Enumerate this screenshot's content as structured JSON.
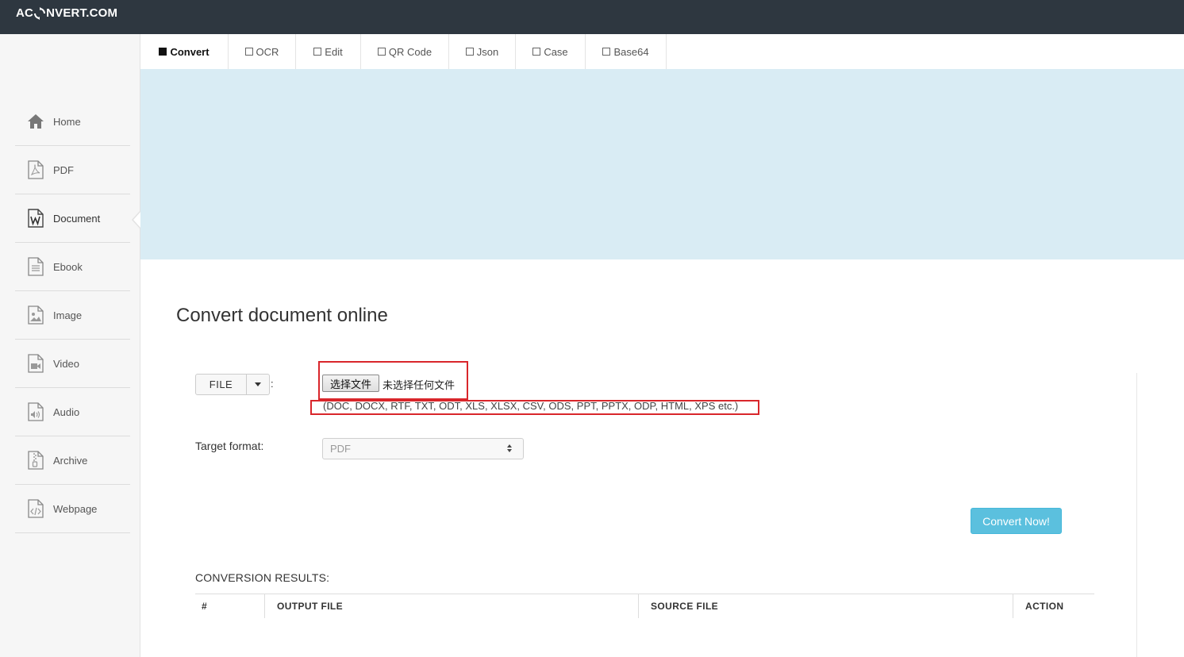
{
  "brand": {
    "logo_prefix": "AC",
    "logo_suffix": "NVERT.COM"
  },
  "tabs": [
    {
      "label": "Convert",
      "active": true
    },
    {
      "label": "OCR",
      "active": false
    },
    {
      "label": "Edit",
      "active": false
    },
    {
      "label": "QR Code",
      "active": false
    },
    {
      "label": "Json",
      "active": false
    },
    {
      "label": "Case",
      "active": false
    },
    {
      "label": "Base64",
      "active": false
    }
  ],
  "sidebar": {
    "items": [
      {
        "label": "Home",
        "icon": "home-icon"
      },
      {
        "label": "PDF",
        "icon": "pdf-file-icon"
      },
      {
        "label": "Document",
        "icon": "word-document-icon",
        "active": true
      },
      {
        "label": "Ebook",
        "icon": "ebook-icon"
      },
      {
        "label": "Image",
        "icon": "image-file-icon"
      },
      {
        "label": "Video",
        "icon": "video-file-icon"
      },
      {
        "label": "Audio",
        "icon": "audio-file-icon"
      },
      {
        "label": "Archive",
        "icon": "archive-file-icon"
      },
      {
        "label": "Webpage",
        "icon": "webpage-file-icon"
      }
    ]
  },
  "main": {
    "title": "Convert document online",
    "file_button": "FILE",
    "colon": ":",
    "choose_file_label": "选择文件",
    "no_file_chosen": "未选择任何文件",
    "supported_formats": "(DOC, DOCX, RTF, TXT, ODT, XLS, XLSX, CSV, ODS, PPT, PPTX, ODP, HTML, XPS etc.)",
    "target_label": "Target format:",
    "target_value": "PDF",
    "convert_button": "Convert Now!",
    "results_title": "CONVERSION RESULTS:",
    "results_columns": [
      "#",
      "OUTPUT FILE",
      "SOURCE FILE",
      "ACTION"
    ]
  },
  "colors": {
    "topbar": "#2e3740",
    "banner": "#d9ecf4",
    "convert_button": "#5bc0de",
    "highlight_border": "#d9262b"
  }
}
